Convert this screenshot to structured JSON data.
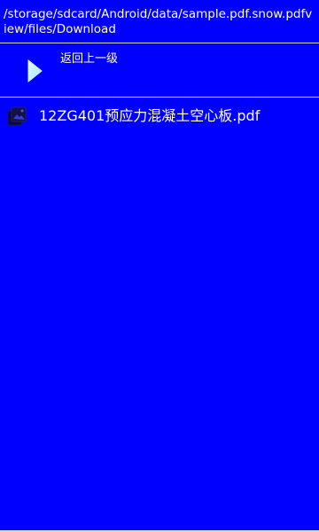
{
  "current_path": "/storage/sdcard/Android/data/sample.pdf.snow.pdfview/files/Download",
  "back_item": {
    "label": "返回上一级",
    "icon": "play-arrow-icon"
  },
  "files": [
    {
      "name": "12ZG401预应力混凝土空心板.pdf",
      "icon": "image-collection-icon"
    }
  ],
  "colors": {
    "background": "#0000ff",
    "text": "#ffffff",
    "divider": "#cfd3ff",
    "icon_glow": "#8fe9ff"
  }
}
